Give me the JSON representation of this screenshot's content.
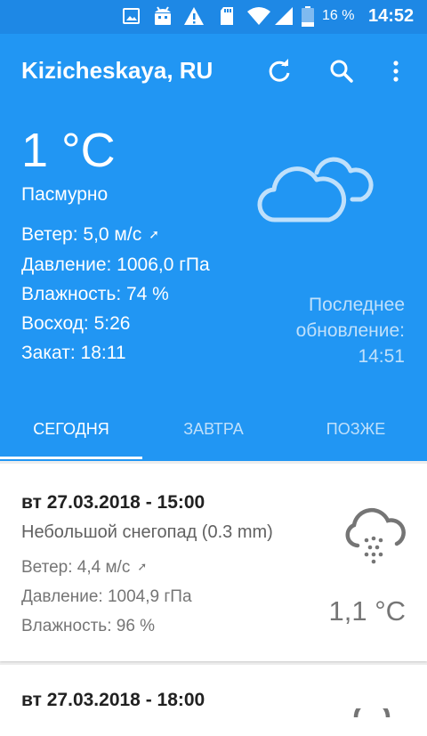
{
  "status_bar": {
    "battery": "16 %",
    "time": "14:52",
    "icons": [
      "image-icon",
      "android-icon",
      "warning-icon",
      "sd-card-icon",
      "wifi-icon",
      "signal-icon",
      "battery-icon"
    ]
  },
  "toolbar": {
    "title": "Kizicheskaya, RU",
    "actions": [
      "refresh-icon",
      "search-icon",
      "more-vert-icon"
    ]
  },
  "current": {
    "temperature": "1 °C",
    "description": "Пасмурно",
    "wind": "Ветер: 5,0 м/с",
    "wind_arrow": "➚",
    "pressure": "Давление: 1006,0 гПа",
    "humidity": "Влажность: 74 %",
    "sunrise": "Восход: 5:26",
    "sunset": "Закат: 18:11",
    "last_update_line1": "Последнее",
    "last_update_line2": "обновление:",
    "last_update_time": "14:51",
    "icon": "cloud-icon"
  },
  "tabs": [
    {
      "label": "СЕГОДНЯ",
      "active": true
    },
    {
      "label": "ЗАВТРА",
      "active": false
    },
    {
      "label": "ПОЗЖЕ",
      "active": false
    }
  ],
  "forecast": [
    {
      "date": "вт 27.03.2018 - 15:00",
      "description": "Небольшой снегопад (0.3 mm)",
      "wind": "Ветер: 4,4 м/с",
      "wind_arrow": "➚",
      "pressure": "Давление: 1004,9 гПа",
      "humidity": "Влажность: 96 %",
      "temperature": "1,1 °C",
      "icon": "snow-cloud-icon"
    },
    {
      "date": "вт 27.03.2018 - 18:00"
    }
  ],
  "colors": {
    "primary": "#2196f3",
    "primary_dark": "#1e88e5",
    "tab_inactive": "#bfe0fb",
    "card_bg": "#ffffff",
    "page_bg": "#eeeeee"
  }
}
